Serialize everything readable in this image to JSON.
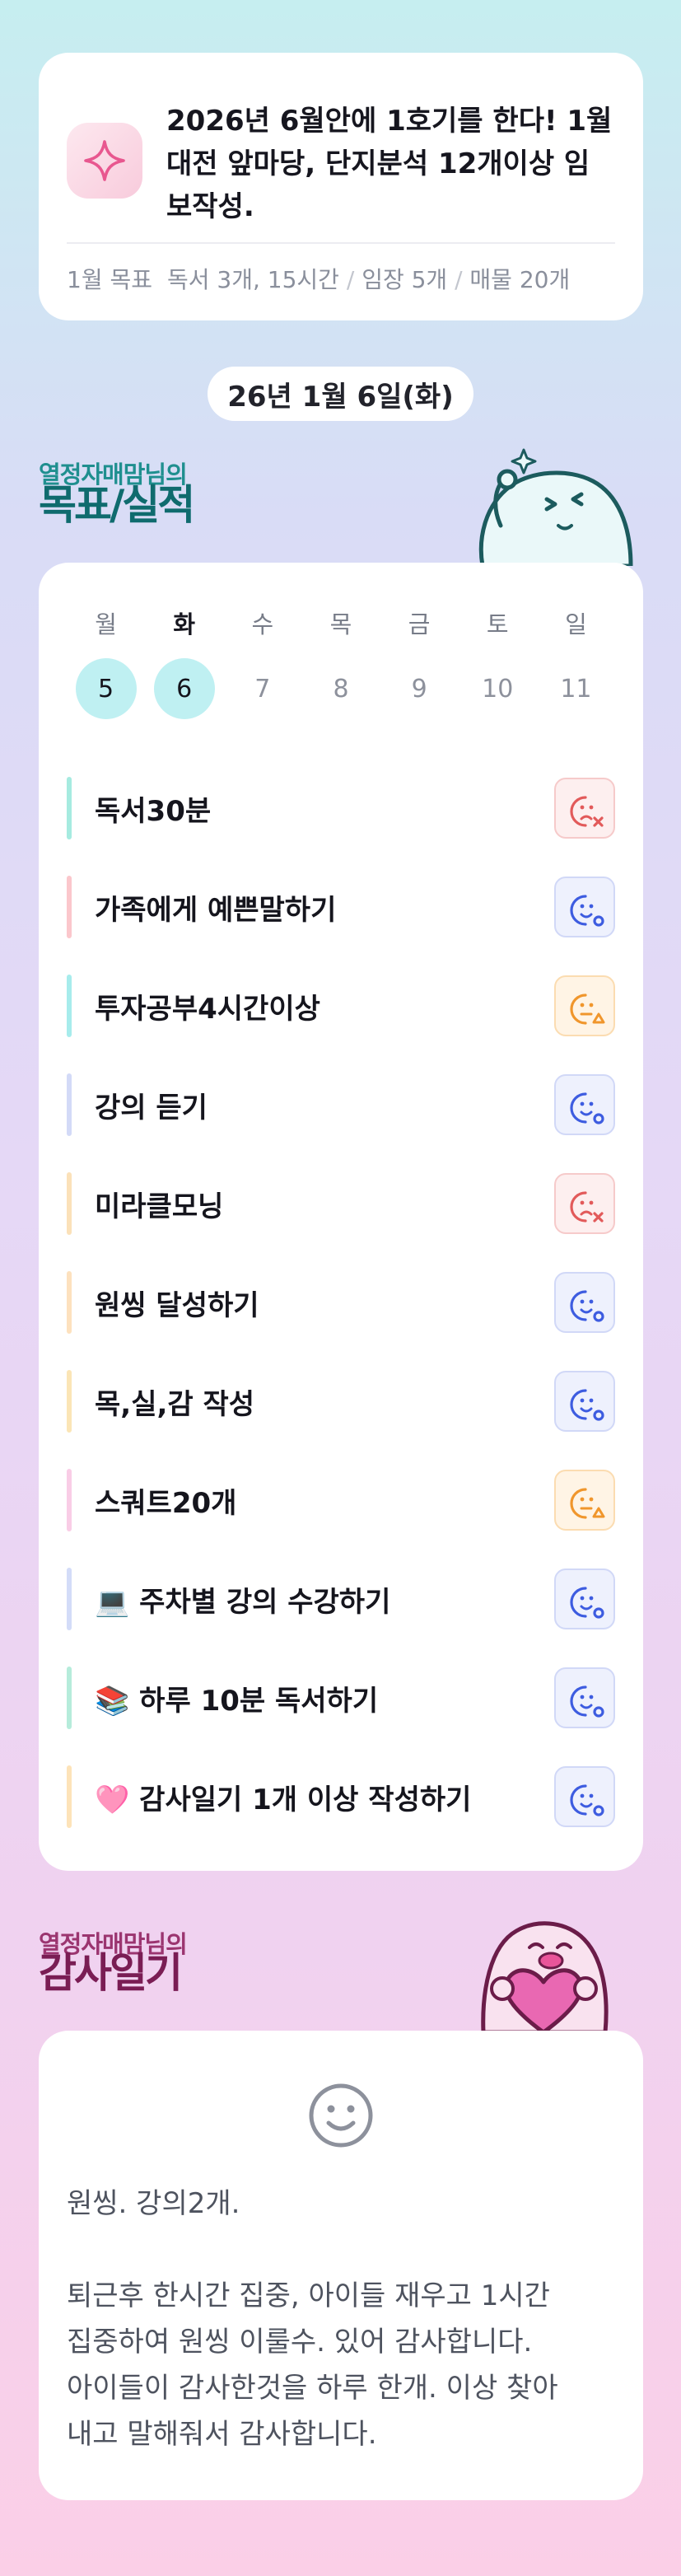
{
  "goal": {
    "text": "2026년 6월안에 1호기를 한다! 1월\n대전 앞마당, 단지분석 12개이상 임\n보작성.",
    "month_label": "1월 목표",
    "month_parts": [
      "독서 3개, 15시간",
      "임장 5개",
      "매물 20개"
    ]
  },
  "date": "26년 1월 6일(화)",
  "goals_section": {
    "subtitle": "열정자매맘님의",
    "title": "목표/실적"
  },
  "week": [
    {
      "day": "월",
      "date": "5",
      "state": "done"
    },
    {
      "day": "화",
      "date": "6",
      "state": "today"
    },
    {
      "day": "수",
      "date": "7",
      "state": "future"
    },
    {
      "day": "목",
      "date": "8",
      "state": "future"
    },
    {
      "day": "금",
      "date": "9",
      "state": "future"
    },
    {
      "day": "토",
      "date": "10",
      "state": "future"
    },
    {
      "day": "일",
      "date": "11",
      "state": "future"
    }
  ],
  "tasks": [
    {
      "label": "독서30분",
      "bar_color": "#a6ebe0",
      "status": "fail"
    },
    {
      "label": "가족에게 예쁜말하기",
      "bar_color": "#fbc7cc",
      "status": "done"
    },
    {
      "label": "투자공부4시간이상",
      "bar_color": "#a7ecec",
      "status": "partial"
    },
    {
      "label": "강의 듣기",
      "bar_color": "#d3daf7",
      "status": "done"
    },
    {
      "label": "미라클모닝",
      "bar_color": "#fbe1b9",
      "status": "fail"
    },
    {
      "label": "원씽 달성하기",
      "bar_color": "#fde1be",
      "status": "done"
    },
    {
      "label": "목,실,감 작성",
      "bar_color": "#fbe5b6",
      "status": "done"
    },
    {
      "label": "스쿼트20개",
      "bar_color": "#f9cde6",
      "status": "partial"
    },
    {
      "label": "💻 주차별 강의 수강하기",
      "bar_color": "#d3dcf8",
      "status": "done"
    },
    {
      "label": "📚 하루 10분 독서하기",
      "bar_color": "#b6ecdb",
      "status": "done"
    },
    {
      "label": "🩷 감사일기 1개 이상 작성하기",
      "bar_color": "#fde3b9",
      "status": "done"
    }
  ],
  "status_style": {
    "done": {
      "bg": "#eef1fd",
      "border": "#d1d8f7",
      "color": "#3d5ce0"
    },
    "partial": {
      "bg": "#fff4e5",
      "border": "#fbdcb1",
      "color": "#f0962c"
    },
    "fail": {
      "bg": "#fdefef",
      "border": "#f6caca",
      "color": "#e25a5a"
    }
  },
  "diary_section": {
    "subtitle": "열정자매맘님의",
    "title": "감사일기"
  },
  "diary": {
    "text": "원씽. 강의2개.\n\n퇴근후 한시간 집중, 아이들 재우고 1시간\n집중하여 원씽 이룰수. 있어 감사합니다.\n아이들이 감사한것을 하루 한개. 이상 찾아\n내고 말해줘서 감사합니다."
  }
}
